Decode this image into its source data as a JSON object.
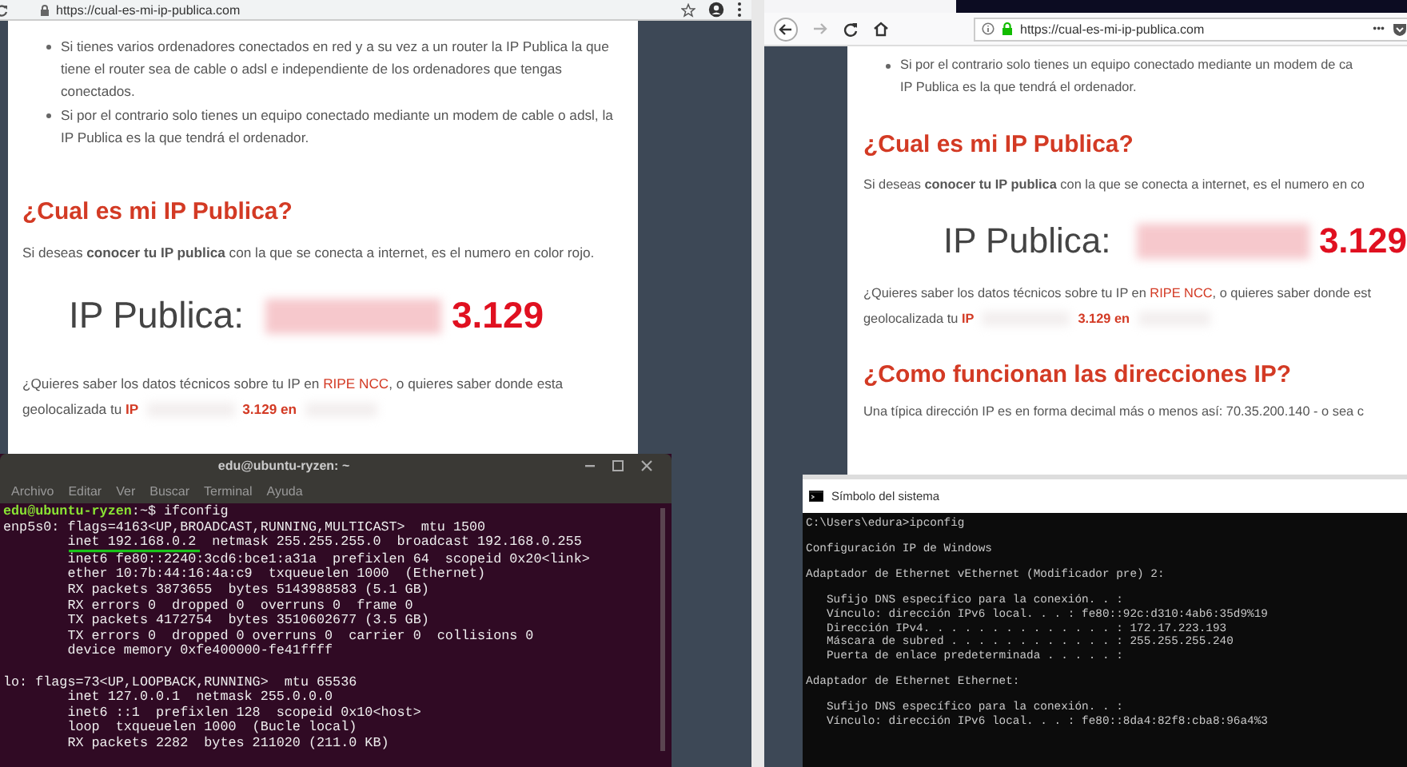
{
  "left_browser": {
    "url": "https://cual-es-mi-ip-publica.com",
    "page": {
      "bullets": [
        "Si tienes varios ordenadores conectados en red y a su vez a un router la IP Publica la que tiene el router sea de cable o adsl e independiente de los ordenadores que tengas conectados.",
        "Si por el contrario solo tienes un equipo conectado mediante un modem de cable o adsl, la IP Publica es la que tendrá el ordenador."
      ],
      "heading": "¿Cual es mi IP Publica?",
      "intro": "Si deseas **conocer tu IP publica** con la que se conecta a internet, es el numero en color rojo.",
      "ip_label": "IP Publica:",
      "ip_value": "3.129",
      "question": {
        "before": "¿Quieres saber los datos técnicos sobre tu IP en ",
        "link": "RIPE NCC",
        "after": ", o quieres saber donde esta"
      },
      "geo": {
        "prefix": "geolocalizada tu ",
        "ip": "IP",
        "suffix": "3.129 en"
      }
    }
  },
  "right_browser": {
    "nav_buttons": [
      {
        "kind": "back",
        "disabled": false
      },
      {
        "kind": "forward",
        "disabled": true
      },
      {
        "kind": "reload",
        "disabled": false
      },
      {
        "kind": "home",
        "disabled": false
      }
    ],
    "url": "https://cual-es-mi-ip-publica.com",
    "more": "•••",
    "page": {
      "bullet_lines": [
        "Si por el contrario solo tienes un equipo conectado mediante un modem de ca",
        "IP Publica es la que tendrá el ordenador."
      ],
      "heading": "¿Cual es mi IP Publica?",
      "intro": "Si deseas **conocer tu IP publica** con la que se conecta a internet, es el numero en co",
      "ip_label": "IP Publica:",
      "ip_value": "3.129",
      "question": {
        "before": "¿Quieres saber los datos técnicos sobre tu IP en ",
        "link": "RIPE NCC",
        "after": ", o quieres saber donde est"
      },
      "geo": {
        "prefix": "geolocalizada tu ",
        "ip": "IP",
        "suffix": "3.129 en"
      },
      "heading_2": "¿Como funcionan las direcciones IP?",
      "paragraph_2": "Una típica dirección IP es en forma decimal más o menos así: 70.35.200.140 - o sea c"
    }
  },
  "terminal": {
    "title": "edu@ubuntu-ryzen: ~",
    "menu": [
      "Archivo",
      "Editar",
      "Ver",
      "Buscar",
      "Terminal",
      "Ayuda"
    ],
    "prompt": {
      "user": "edu@ubuntu-ryzen",
      "rest": ":~$ ifconfig"
    },
    "blocks": [
      {
        "lines": [
          {
            "text": "enp5s0: flags=4163<UP,BROADCAST,RUNNING,MULTICAST>  mtu 1500",
            "underlined": false
          },
          {
            "text": "        inet 192.168.0.2  netmask 255.255.255.0  broadcast 192.168.0.255",
            "underlined": true
          },
          {
            "text": "        inet6 fe80::2240:3cd6:bce1:a31a  prefixlen 64  scopeid 0x20<link>",
            "underlined": false
          },
          {
            "text": "        ether 10:7b:44:16:4a:c9  txqueuelen 1000  (Ethernet)",
            "underlined": false
          },
          {
            "text": "        RX packets 3873655  bytes 5143988583 (5.1 GB)",
            "underlined": false
          },
          {
            "text": "        RX errors 0  dropped 0  overruns 0  frame 0",
            "underlined": false
          },
          {
            "text": "        TX packets 4172754  bytes 3510602677 (3.5 GB)",
            "underlined": false
          },
          {
            "text": "        TX errors 0  dropped 0 overruns 0  carrier 0  collisions 0",
            "underlined": false
          },
          {
            "text": "        device memory 0xfe400000-fe41ffff",
            "underlined": false
          }
        ]
      },
      {
        "lines": [
          {
            "text": "lo: flags=73<UP,LOOPBACK,RUNNING>  mtu 65536",
            "underlined": false
          },
          {
            "text": "        inet 127.0.0.1  netmask 255.0.0.0",
            "underlined": false
          },
          {
            "text": "        inet6 ::1  prefixlen 128  scopeid 0x10<host>",
            "underlined": false
          },
          {
            "text": "        loop  txqueuelen 1000  (Bucle local)",
            "underlined": false
          },
          {
            "text": "        RX packets 2282  bytes 211020 (211.0 KB)",
            "underlined": false
          }
        ]
      }
    ]
  },
  "cmd": {
    "title": "Símbolo del sistema",
    "blocks": [
      {
        "lines": [
          "C:\\Users\\edura>ipconfig"
        ]
      },
      {
        "lines": [
          "Configuración IP de Windows"
        ]
      },
      {
        "lines": [
          "Adaptador de Ethernet vEthernet (Modificador pre) 2:"
        ]
      },
      {
        "lines": [
          "   Sufijo DNS específico para la conexión. . :",
          "   Vínculo: dirección IPv6 local. . . : fe80::92c:d310:4ab6:35d9%19",
          "   Dirección IPv4. . . . . . . . . . . . . . : 172.17.223.193",
          "   Máscara de subred . . . . . . . . . . . . : 255.255.255.240",
          "   Puerta de enlace predeterminada . . . . . :"
        ]
      },
      {
        "lines": [
          "Adaptador de Ethernet Ethernet:"
        ]
      },
      {
        "lines": [
          "   Sufijo DNS específico para la conexión. . :",
          "   Vínculo: dirección IPv6 local. . . : fe80::8da4:82f8:cba8:96a4%3"
        ]
      }
    ]
  }
}
